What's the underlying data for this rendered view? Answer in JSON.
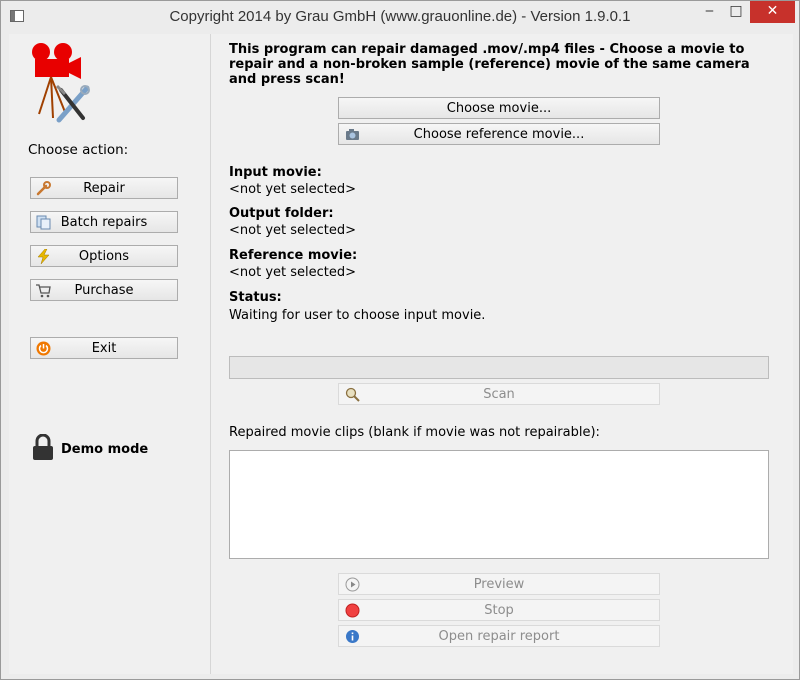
{
  "window": {
    "title": "Copyright 2014 by Grau GmbH (www.grauonline.de) - Version 1.9.0.1",
    "controls": {
      "minimize": "‒",
      "maximize": "□",
      "close": "✕"
    }
  },
  "sidebar": {
    "choose_label": "Choose action:",
    "buttons": {
      "repair": "Repair",
      "batch": "Batch repairs",
      "options": "Options",
      "purchase": "Purchase",
      "exit": "Exit"
    },
    "demo_mode": "Demo mode"
  },
  "main": {
    "intro": "This program can repair damaged .mov/.mp4 files - Choose a movie to repair and a non-broken sample (reference) movie of the same camera and press scan!",
    "choose_movie": "Choose movie...",
    "choose_reference": "Choose reference movie...",
    "input_movie_label": "Input movie:",
    "input_movie_value": "<not yet selected>",
    "output_folder_label": "Output folder:",
    "output_folder_value": "<not yet selected>",
    "reference_movie_label": "Reference movie:",
    "reference_movie_value": "<not yet selected>",
    "status_label": "Status:",
    "status_value": "Waiting for user to choose input movie.",
    "progress": 0,
    "scan": "Scan",
    "clips_label": "Repaired movie clips (blank if movie was not repairable):",
    "preview": "Preview",
    "stop": "Stop",
    "open_report": "Open repair report"
  },
  "colors": {
    "close_button": "#c7312b",
    "camera_red": "#e80000"
  }
}
